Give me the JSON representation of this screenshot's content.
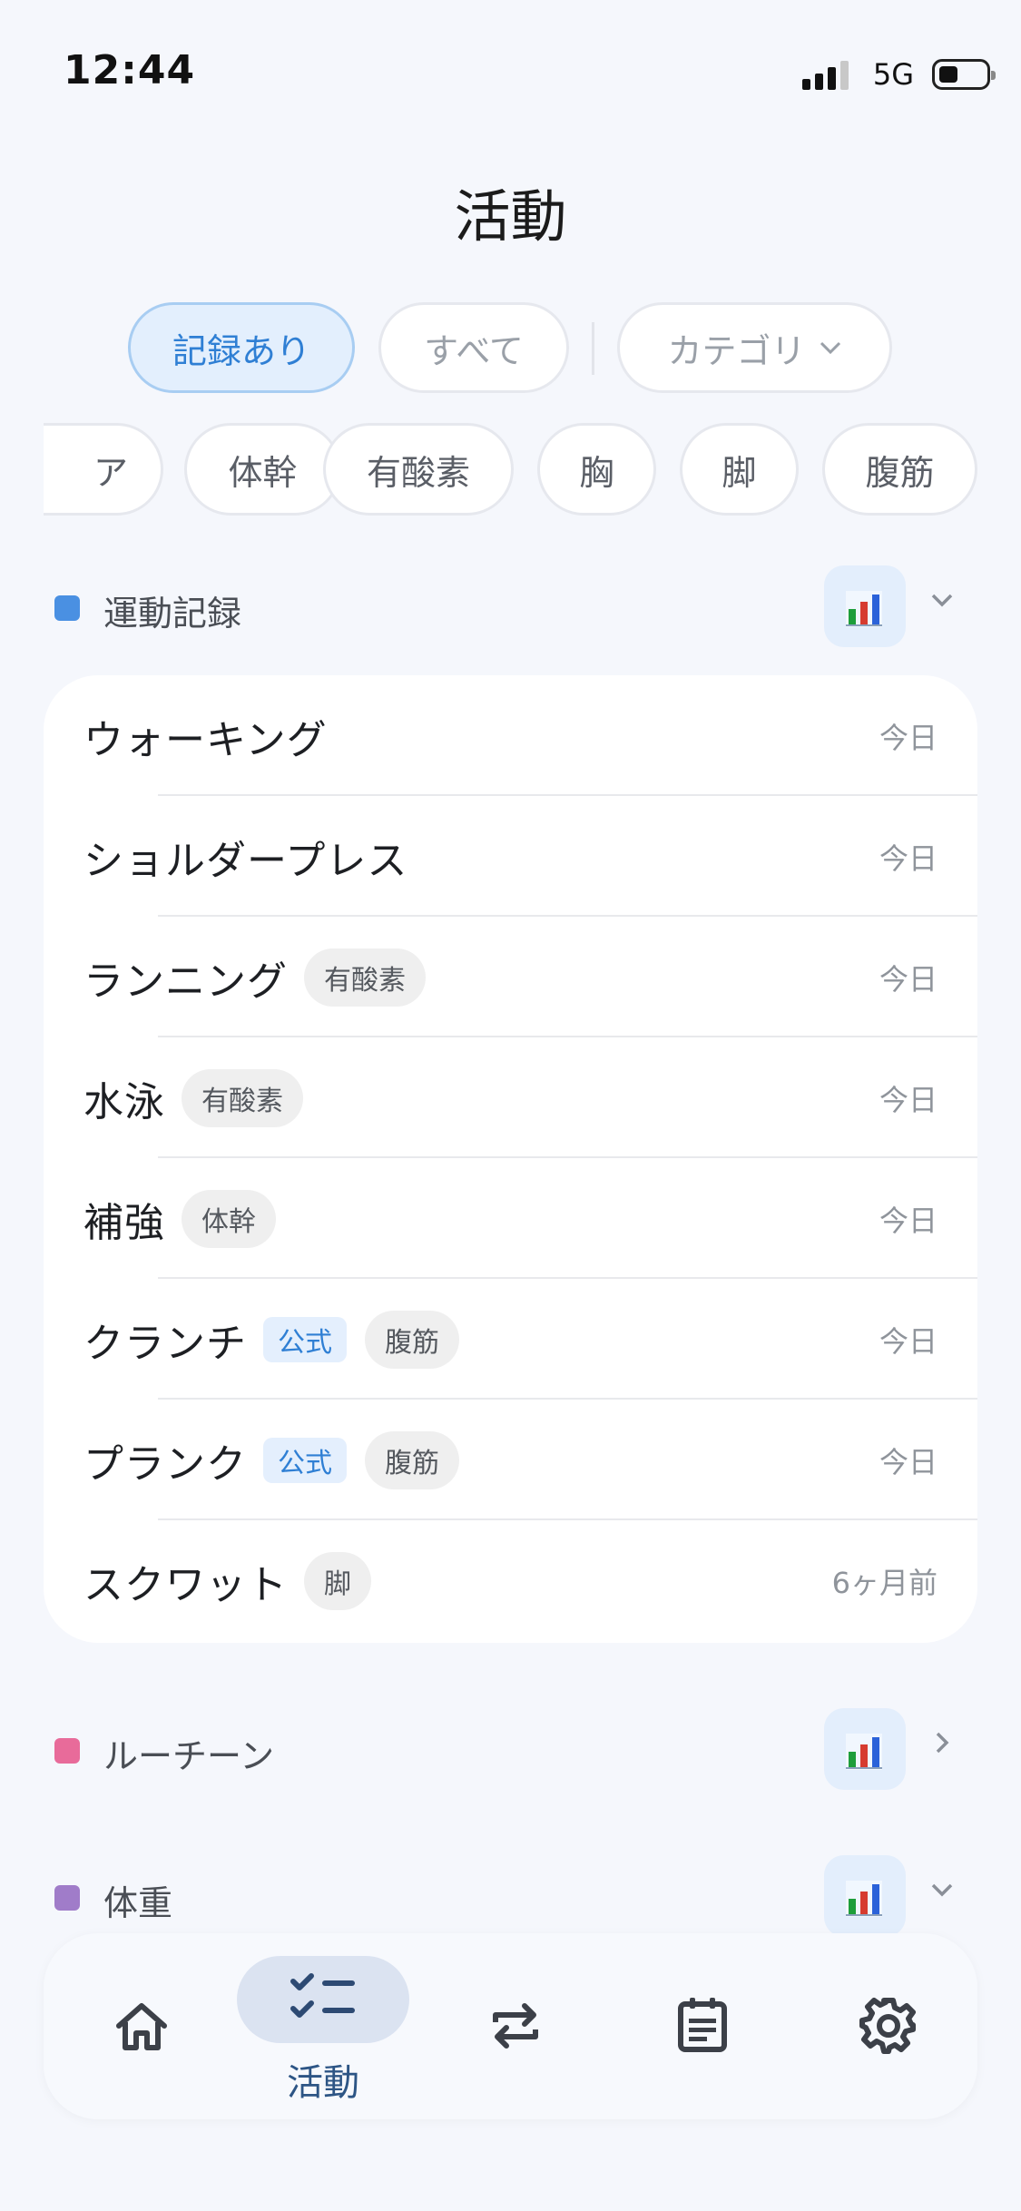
{
  "status_bar": {
    "time": "12:44",
    "network": "5G"
  },
  "page_title": "活動",
  "filters": {
    "recorded": "記録あり",
    "all": "すべて",
    "category": "カテゴリ"
  },
  "categories": [
    "ア",
    "体幹",
    "有酸素",
    "胸",
    "脚",
    "腹筋"
  ],
  "sections": {
    "exercise": {
      "label": "運動記録",
      "color": "#4a90e2"
    },
    "routine": {
      "label": "ルーチーン",
      "color": "#e86b9a"
    },
    "weight": {
      "label": "体重",
      "color": "#a07cc9"
    }
  },
  "stat_icon_colors": {
    "green": "#1e9e3a",
    "red": "#d63b2f",
    "blue": "#2b62d9"
  },
  "activities": [
    {
      "name": "ウォーキング",
      "tags": [],
      "date": "今日"
    },
    {
      "name": "ショルダープレス",
      "tags": [],
      "date": "今日"
    },
    {
      "name": "ランニング",
      "tags": [
        "有酸素"
      ],
      "date": "今日"
    },
    {
      "name": "水泳",
      "tags": [
        "有酸素"
      ],
      "date": "今日"
    },
    {
      "name": "補強",
      "tags": [
        "体幹"
      ],
      "date": "今日"
    },
    {
      "name": "クランチ",
      "official": "公式",
      "tags": [
        "腹筋"
      ],
      "date": "今日"
    },
    {
      "name": "プランク",
      "official": "公式",
      "tags": [
        "腹筋"
      ],
      "date": "今日"
    },
    {
      "name": "スクワット",
      "tags": [
        "脚"
      ],
      "date": "6ヶ月前"
    }
  ],
  "nav": {
    "active_label": "活動"
  }
}
